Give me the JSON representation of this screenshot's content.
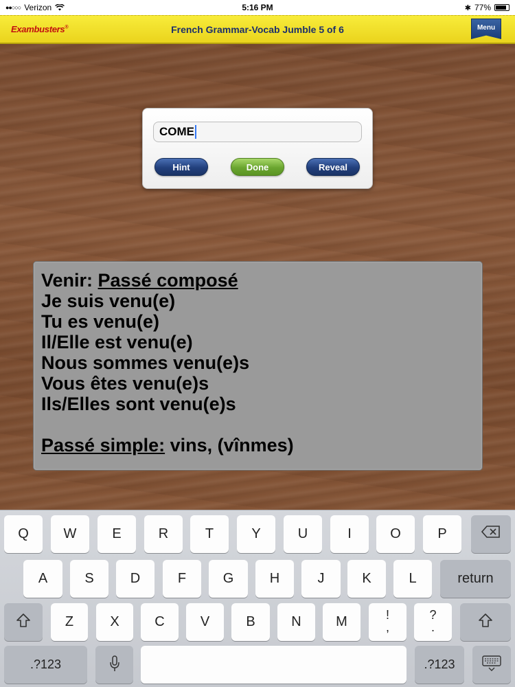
{
  "status_bar": {
    "carrier": "Verizon",
    "time": "5:16 PM",
    "battery": "77%"
  },
  "header": {
    "logo": "Exambusters",
    "logo_mark": "®",
    "title": "French Grammar-Vocab Jumble 5 of 6",
    "menu_label": "Menu"
  },
  "answer_card": {
    "input_value": "COME",
    "hint_label": "Hint",
    "done_label": "Done",
    "reveal_label": "Reveal"
  },
  "info_panel": {
    "line1_prefix": "Venir: ",
    "line1_underlined": "Passé composé",
    "lines": [
      "Je suis venu(e)",
      "Tu es venu(e)",
      "Il/Elle est venu(e)",
      "Nous sommes venu(e)s",
      "Vous êtes venu(e)s",
      "Ils/Elles sont venu(e)s"
    ],
    "footer_underlined": "Passé simple:",
    "footer_rest": " vins, (vînmes)"
  },
  "keyboard": {
    "row1": [
      "Q",
      "W",
      "E",
      "R",
      "T",
      "Y",
      "U",
      "I",
      "O",
      "P"
    ],
    "row2": [
      "A",
      "S",
      "D",
      "F",
      "G",
      "H",
      "J",
      "K",
      "L"
    ],
    "row3": [
      "Z",
      "X",
      "C",
      "V",
      "B",
      "N",
      "M"
    ],
    "return_label": "return",
    "numbers_label": ".?123",
    "exclaim_top": "!",
    "exclaim_bottom": ",",
    "question_top": "?",
    "question_bottom": "."
  }
}
